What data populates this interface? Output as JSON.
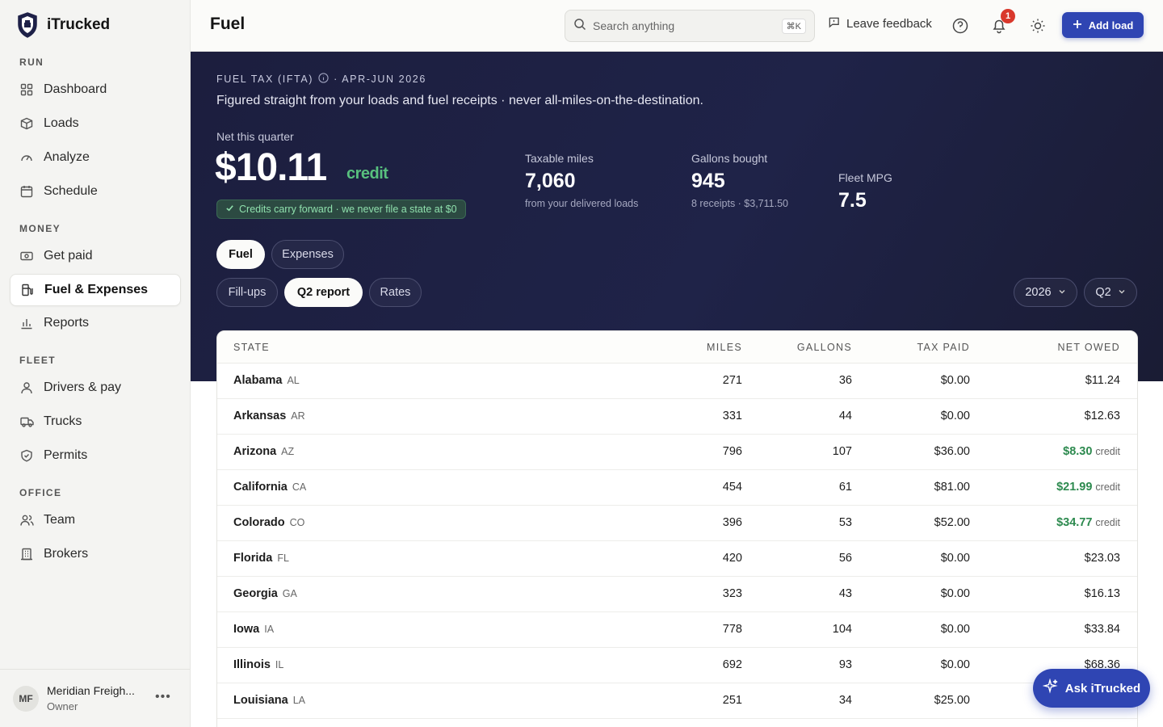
{
  "app": {
    "name": "iTrucked"
  },
  "sidebar": {
    "sections": [
      {
        "label": "RUN",
        "items": [
          {
            "label": "Dashboard",
            "icon": "grid-icon"
          },
          {
            "label": "Loads",
            "icon": "box-icon"
          },
          {
            "label": "Analyze",
            "icon": "gauge-icon"
          },
          {
            "label": "Schedule",
            "icon": "calendar-icon"
          }
        ]
      },
      {
        "label": "MONEY",
        "items": [
          {
            "label": "Get paid",
            "icon": "cash-icon"
          },
          {
            "label": "Fuel & Expenses",
            "icon": "fuel-pump-icon",
            "active": true
          },
          {
            "label": "Reports",
            "icon": "bar-chart-icon"
          }
        ]
      },
      {
        "label": "FLEET",
        "items": [
          {
            "label": "Drivers & pay",
            "icon": "user-icon"
          },
          {
            "label": "Trucks",
            "icon": "truck-icon"
          },
          {
            "label": "Permits",
            "icon": "shield-icon"
          }
        ]
      },
      {
        "label": "OFFICE",
        "items": [
          {
            "label": "Team",
            "icon": "users-icon"
          },
          {
            "label": "Brokers",
            "icon": "building-icon"
          }
        ]
      }
    ],
    "footer": {
      "initials": "MF",
      "org": "Meridian Freigh...",
      "role": "Owner"
    }
  },
  "topbar": {
    "title": "Fuel",
    "search_placeholder": "Search anything",
    "search_shortcut": "⌘K",
    "feedback_label": "Leave feedback",
    "notification_count": "1",
    "add_load_label": "Add load"
  },
  "hero": {
    "kicker": "FUEL TAX (IFTA)",
    "kicker_period": "· APR-JUN 2026",
    "subtitle": "Figured straight from your loads and fuel receipts · never all-miles-on-the-destination.",
    "net_label": "Net this quarter",
    "net_value": "$10.11",
    "net_suffix": "credit",
    "carry_note": "Credits carry forward · we never file a state at $0",
    "stats": [
      {
        "label": "Taxable miles",
        "value": "7,060",
        "note": "from your delivered loads"
      },
      {
        "label": "Gallons bought",
        "value": "945",
        "note": "8 receipts · $3,711.50"
      },
      {
        "label": "Fleet MPG",
        "value": "7.5",
        "note": ""
      }
    ],
    "tabs_primary": [
      {
        "label": "Fuel",
        "active": true
      },
      {
        "label": "Expenses",
        "active": false
      }
    ],
    "tabs_secondary": [
      {
        "label": "Fill-ups",
        "active": false
      },
      {
        "label": "Q2 report",
        "active": true
      },
      {
        "label": "Rates",
        "active": false
      }
    ],
    "year": "2026",
    "quarter": "Q2"
  },
  "table": {
    "headers": {
      "state": "STATE",
      "miles": "MILES",
      "gallons": "GALLONS",
      "tax_paid": "TAX PAID",
      "net_owed": "NET OWED"
    },
    "rows": [
      {
        "state": "Alabama",
        "code": "AL",
        "miles": "271",
        "gallons": "36",
        "tax_paid": "$0.00",
        "net_owed": "$11.24",
        "credit": false
      },
      {
        "state": "Arkansas",
        "code": "AR",
        "miles": "331",
        "gallons": "44",
        "tax_paid": "$0.00",
        "net_owed": "$12.63",
        "credit": false
      },
      {
        "state": "Arizona",
        "code": "AZ",
        "miles": "796",
        "gallons": "107",
        "tax_paid": "$36.00",
        "net_owed": "$8.30",
        "credit": true
      },
      {
        "state": "California",
        "code": "CA",
        "miles": "454",
        "gallons": "61",
        "tax_paid": "$81.00",
        "net_owed": "$21.99",
        "credit": true
      },
      {
        "state": "Colorado",
        "code": "CO",
        "miles": "396",
        "gallons": "53",
        "tax_paid": "$52.00",
        "net_owed": "$34.77",
        "credit": true
      },
      {
        "state": "Florida",
        "code": "FL",
        "miles": "420",
        "gallons": "56",
        "tax_paid": "$0.00",
        "net_owed": "$23.03",
        "credit": false
      },
      {
        "state": "Georgia",
        "code": "GA",
        "miles": "323",
        "gallons": "43",
        "tax_paid": "$0.00",
        "net_owed": "$16.13",
        "credit": false
      },
      {
        "state": "Iowa",
        "code": "IA",
        "miles": "778",
        "gallons": "104",
        "tax_paid": "$0.00",
        "net_owed": "$33.84",
        "credit": false
      },
      {
        "state": "Illinois",
        "code": "IL",
        "miles": "692",
        "gallons": "93",
        "tax_paid": "$0.00",
        "net_owed": "$68.36",
        "credit": false
      },
      {
        "state": "Louisiana",
        "code": "LA",
        "miles": "251",
        "gallons": "34",
        "tax_paid": "$25.00",
        "net_owed": "",
        "credit": false
      }
    ],
    "credit_word": "credit"
  },
  "ask_button_label": "Ask iTrucked",
  "colors": {
    "accent": "#2f45b3",
    "credit_green": "#2d8a4f",
    "hero_bg": "#1f2348"
  }
}
